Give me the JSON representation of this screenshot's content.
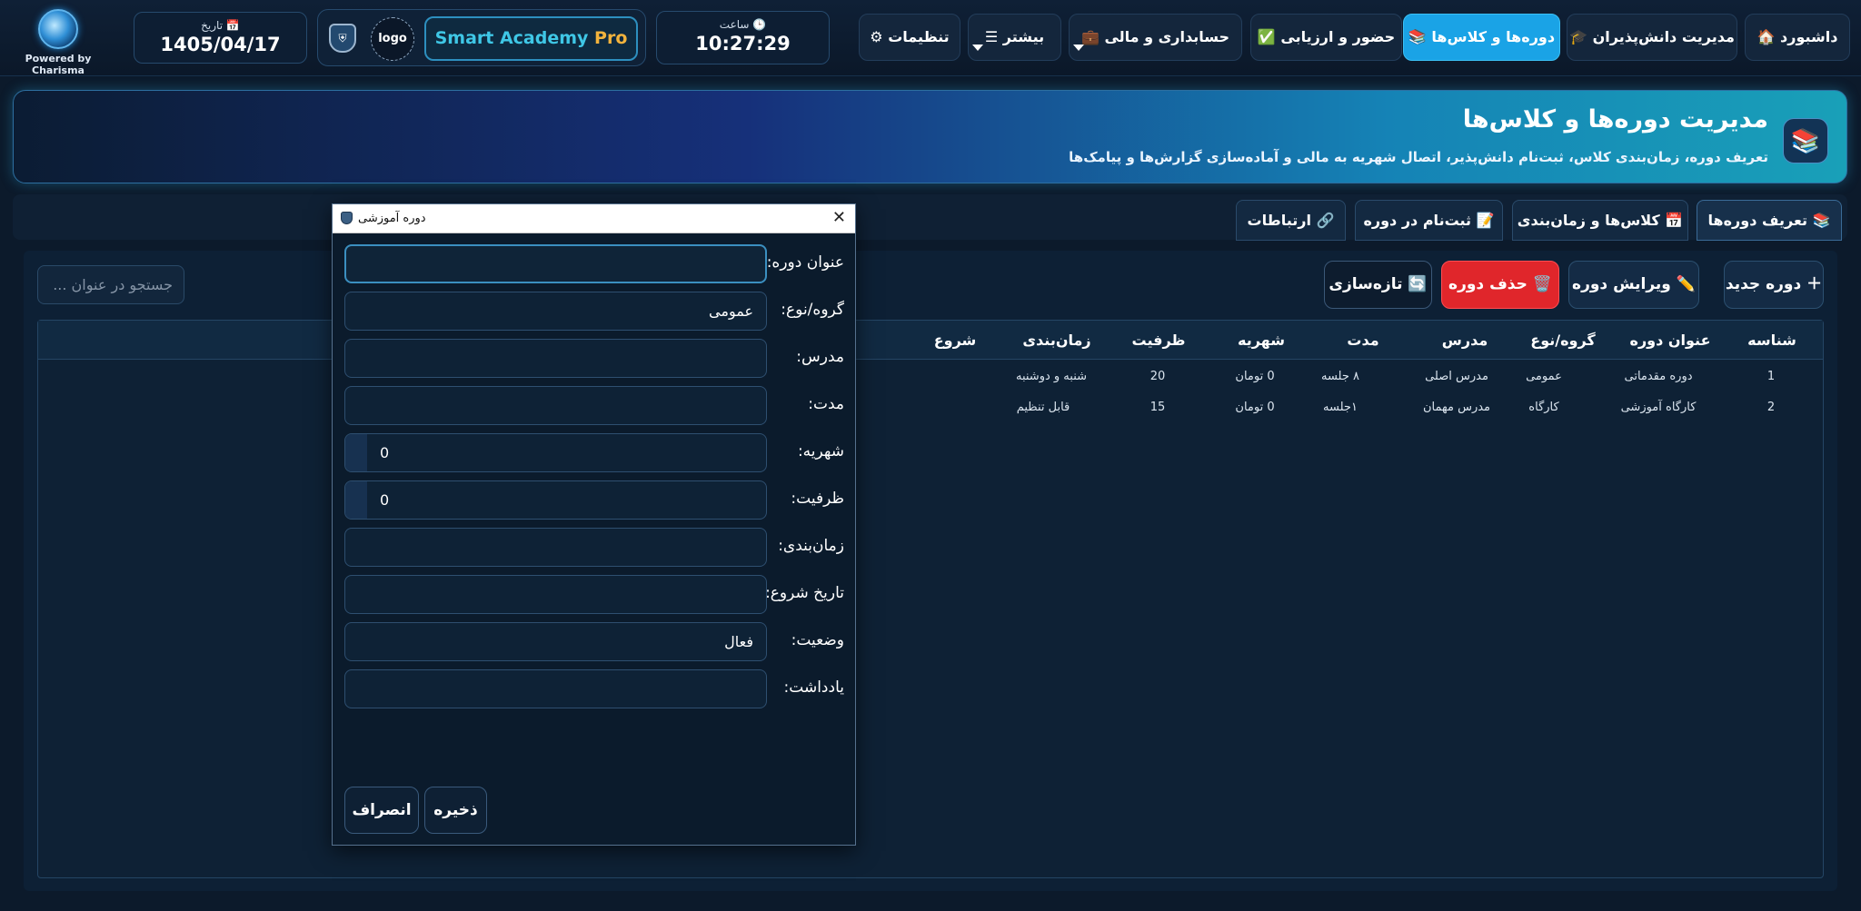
{
  "brand": {
    "powered_by": "Powered by Charisma"
  },
  "header": {
    "date_label": "تاریخ 📅",
    "date_value": "1405/04/17",
    "logo_text": "logo",
    "app_name_main": "Smart Academy ",
    "app_name_accent": "Pro",
    "time_label": "ساعت 🕒",
    "time_value": "10:27:29"
  },
  "nav": {
    "dashboard": "🏠 داشبورد",
    "students": "🎓 مدیریت دانش‌پذیران",
    "courses": "📚 دوره‌ها و کلاس‌ها",
    "attendance": "✅ حضور و ارزیابی",
    "accounting": "💼 حسابداری و مالی",
    "more": "☰ بیشتر",
    "settings": "⚙ تنظیمات"
  },
  "banner": {
    "icon": "📚",
    "title": "مدیریت دوره‌ها و کلاس‌ها",
    "subtitle": "تعریف دوره، زمان‌بندی کلاس، ثبت‌نام دانش‌پذیر، اتصال شهریه به مالی و آماده‌سازی گزارش‌ها و پیامک‌ها"
  },
  "tabs": {
    "define": "📚 تعریف دوره‌ها",
    "classes": "📅 کلاس‌ها و زمان‌بندی",
    "enroll": "📝 ثبت‌نام در دوره",
    "links": "🔗 ارتباطات"
  },
  "toolbar": {
    "new": "＋ دوره جدید",
    "edit": "✏️ ویرایش دوره",
    "delete": "🗑️ حذف دوره",
    "refresh": "🔄 تازه‌سازی",
    "search_placeholder": "جستجو در عنوان ..."
  },
  "table": {
    "columns": [
      "شناسه",
      "عنوان دوره",
      "گروه/نوع",
      "مدرس",
      "مدت",
      "شهریه",
      "ظرفیت",
      "زمان‌بندی",
      "شروع"
    ],
    "rows": [
      [
        "1",
        "دوره مقدماتی",
        "عمومی",
        "مدرس اصلی",
        "۸ جلسه",
        "0 تومان",
        "20",
        "شنبه و دوشنبه",
        ""
      ],
      [
        "2",
        "کارگاه آموزشی",
        "کارگاه",
        "مدرس مهمان",
        "۱جلسه",
        "0 تومان",
        "15",
        "قابل تنظیم",
        ""
      ]
    ]
  },
  "dialog": {
    "title": "دوره آموزشی",
    "close": "✕",
    "labels": {
      "title": "عنوان دوره:",
      "group": "گروه/نوع:",
      "teacher": "مدرس:",
      "duration": "مدت:",
      "fee": "شهریه:",
      "capacity": "ظرفیت:",
      "schedule": "زمان‌بندی:",
      "start": "تاریخ شروع:",
      "status": "وضعیت:",
      "note": "یادداشت:"
    },
    "values": {
      "title": "",
      "group": "عمومی",
      "teacher": "",
      "duration": "",
      "fee": "0",
      "capacity": "0",
      "schedule": "",
      "start": "",
      "status": "فعال",
      "note": ""
    },
    "save": "ذخیره",
    "cancel": "انصراف"
  }
}
